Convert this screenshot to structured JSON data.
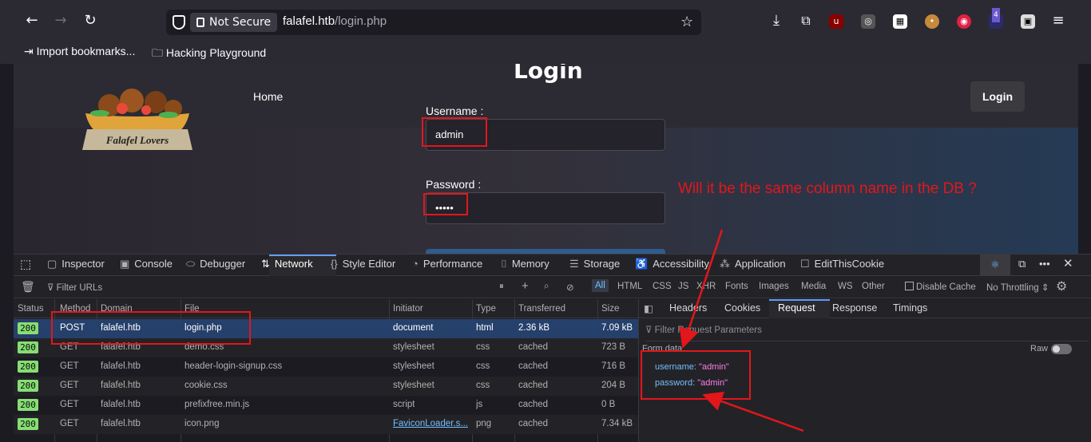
{
  "browser": {
    "not_secure_label": "Not Secure",
    "url_host": "falafel.htb",
    "url_path": "/login.php",
    "bookmarks": [
      "Import bookmarks...",
      "Hacking Playground"
    ],
    "extension_badge": "4"
  },
  "page": {
    "title": "Login",
    "nav_home": "Home",
    "login_button": "Login",
    "logo_text": "Falafel Lovers",
    "username_label": "Username :",
    "username_value": "admin",
    "password_label": "Password :",
    "password_value": "•••••",
    "annotation": "Will it be the same column name in the DB ?"
  },
  "devtools": {
    "tabs": [
      "Inspector",
      "Console",
      "Debugger",
      "Network",
      "Style Editor",
      "Performance",
      "Memory",
      "Storage",
      "Accessibility",
      "Application",
      "EditThisCookie"
    ],
    "active_tab": "Network",
    "filter_placeholder": "Filter URLs",
    "type_filters": [
      "All",
      "HTML",
      "CSS",
      "JS",
      "XHR",
      "Fonts",
      "Images",
      "Media",
      "WS",
      "Other"
    ],
    "disable_cache": "Disable Cache",
    "throttling": "No Throttling ⇕",
    "columns": [
      "Status",
      "Method",
      "Domain",
      "File",
      "Initiator",
      "Type",
      "Transferred",
      "Size"
    ],
    "requests": [
      {
        "status": "200",
        "method": "POST",
        "domain": "falafel.htb",
        "file": "login.php",
        "initiator": "document",
        "type": "html",
        "transferred": "2.36 kB",
        "size": "7.09 kB"
      },
      {
        "status": "200",
        "method": "GET",
        "domain": "falafel.htb",
        "file": "demo.css",
        "initiator": "stylesheet",
        "type": "css",
        "transferred": "cached",
        "size": "723 B"
      },
      {
        "status": "200",
        "method": "GET",
        "domain": "falafel.htb",
        "file": "header-login-signup.css",
        "initiator": "stylesheet",
        "type": "css",
        "transferred": "cached",
        "size": "716 B"
      },
      {
        "status": "200",
        "method": "GET",
        "domain": "falafel.htb",
        "file": "cookie.css",
        "initiator": "stylesheet",
        "type": "css",
        "transferred": "cached",
        "size": "204 B"
      },
      {
        "status": "200",
        "method": "GET",
        "domain": "falafel.htb",
        "file": "prefixfree.min.js",
        "initiator": "script",
        "type": "js",
        "transferred": "cached",
        "size": "0 B"
      },
      {
        "status": "200",
        "method": "GET",
        "domain": "falafel.htb",
        "file": "icon.png",
        "initiator": "FaviconLoader.s...",
        "type": "png",
        "transferred": "cached",
        "size": "7.34 kB"
      }
    ],
    "side_tabs": [
      "Headers",
      "Cookies",
      "Request",
      "Response",
      "Timings"
    ],
    "side_active": "Request",
    "filter_params": "Filter Request Parameters",
    "form_data_label": "Form data",
    "raw_label": "Raw",
    "form_data": [
      {
        "key": "username:",
        "value": "\"admin\""
      },
      {
        "key": "password:",
        "value": "\"admin\""
      }
    ]
  }
}
